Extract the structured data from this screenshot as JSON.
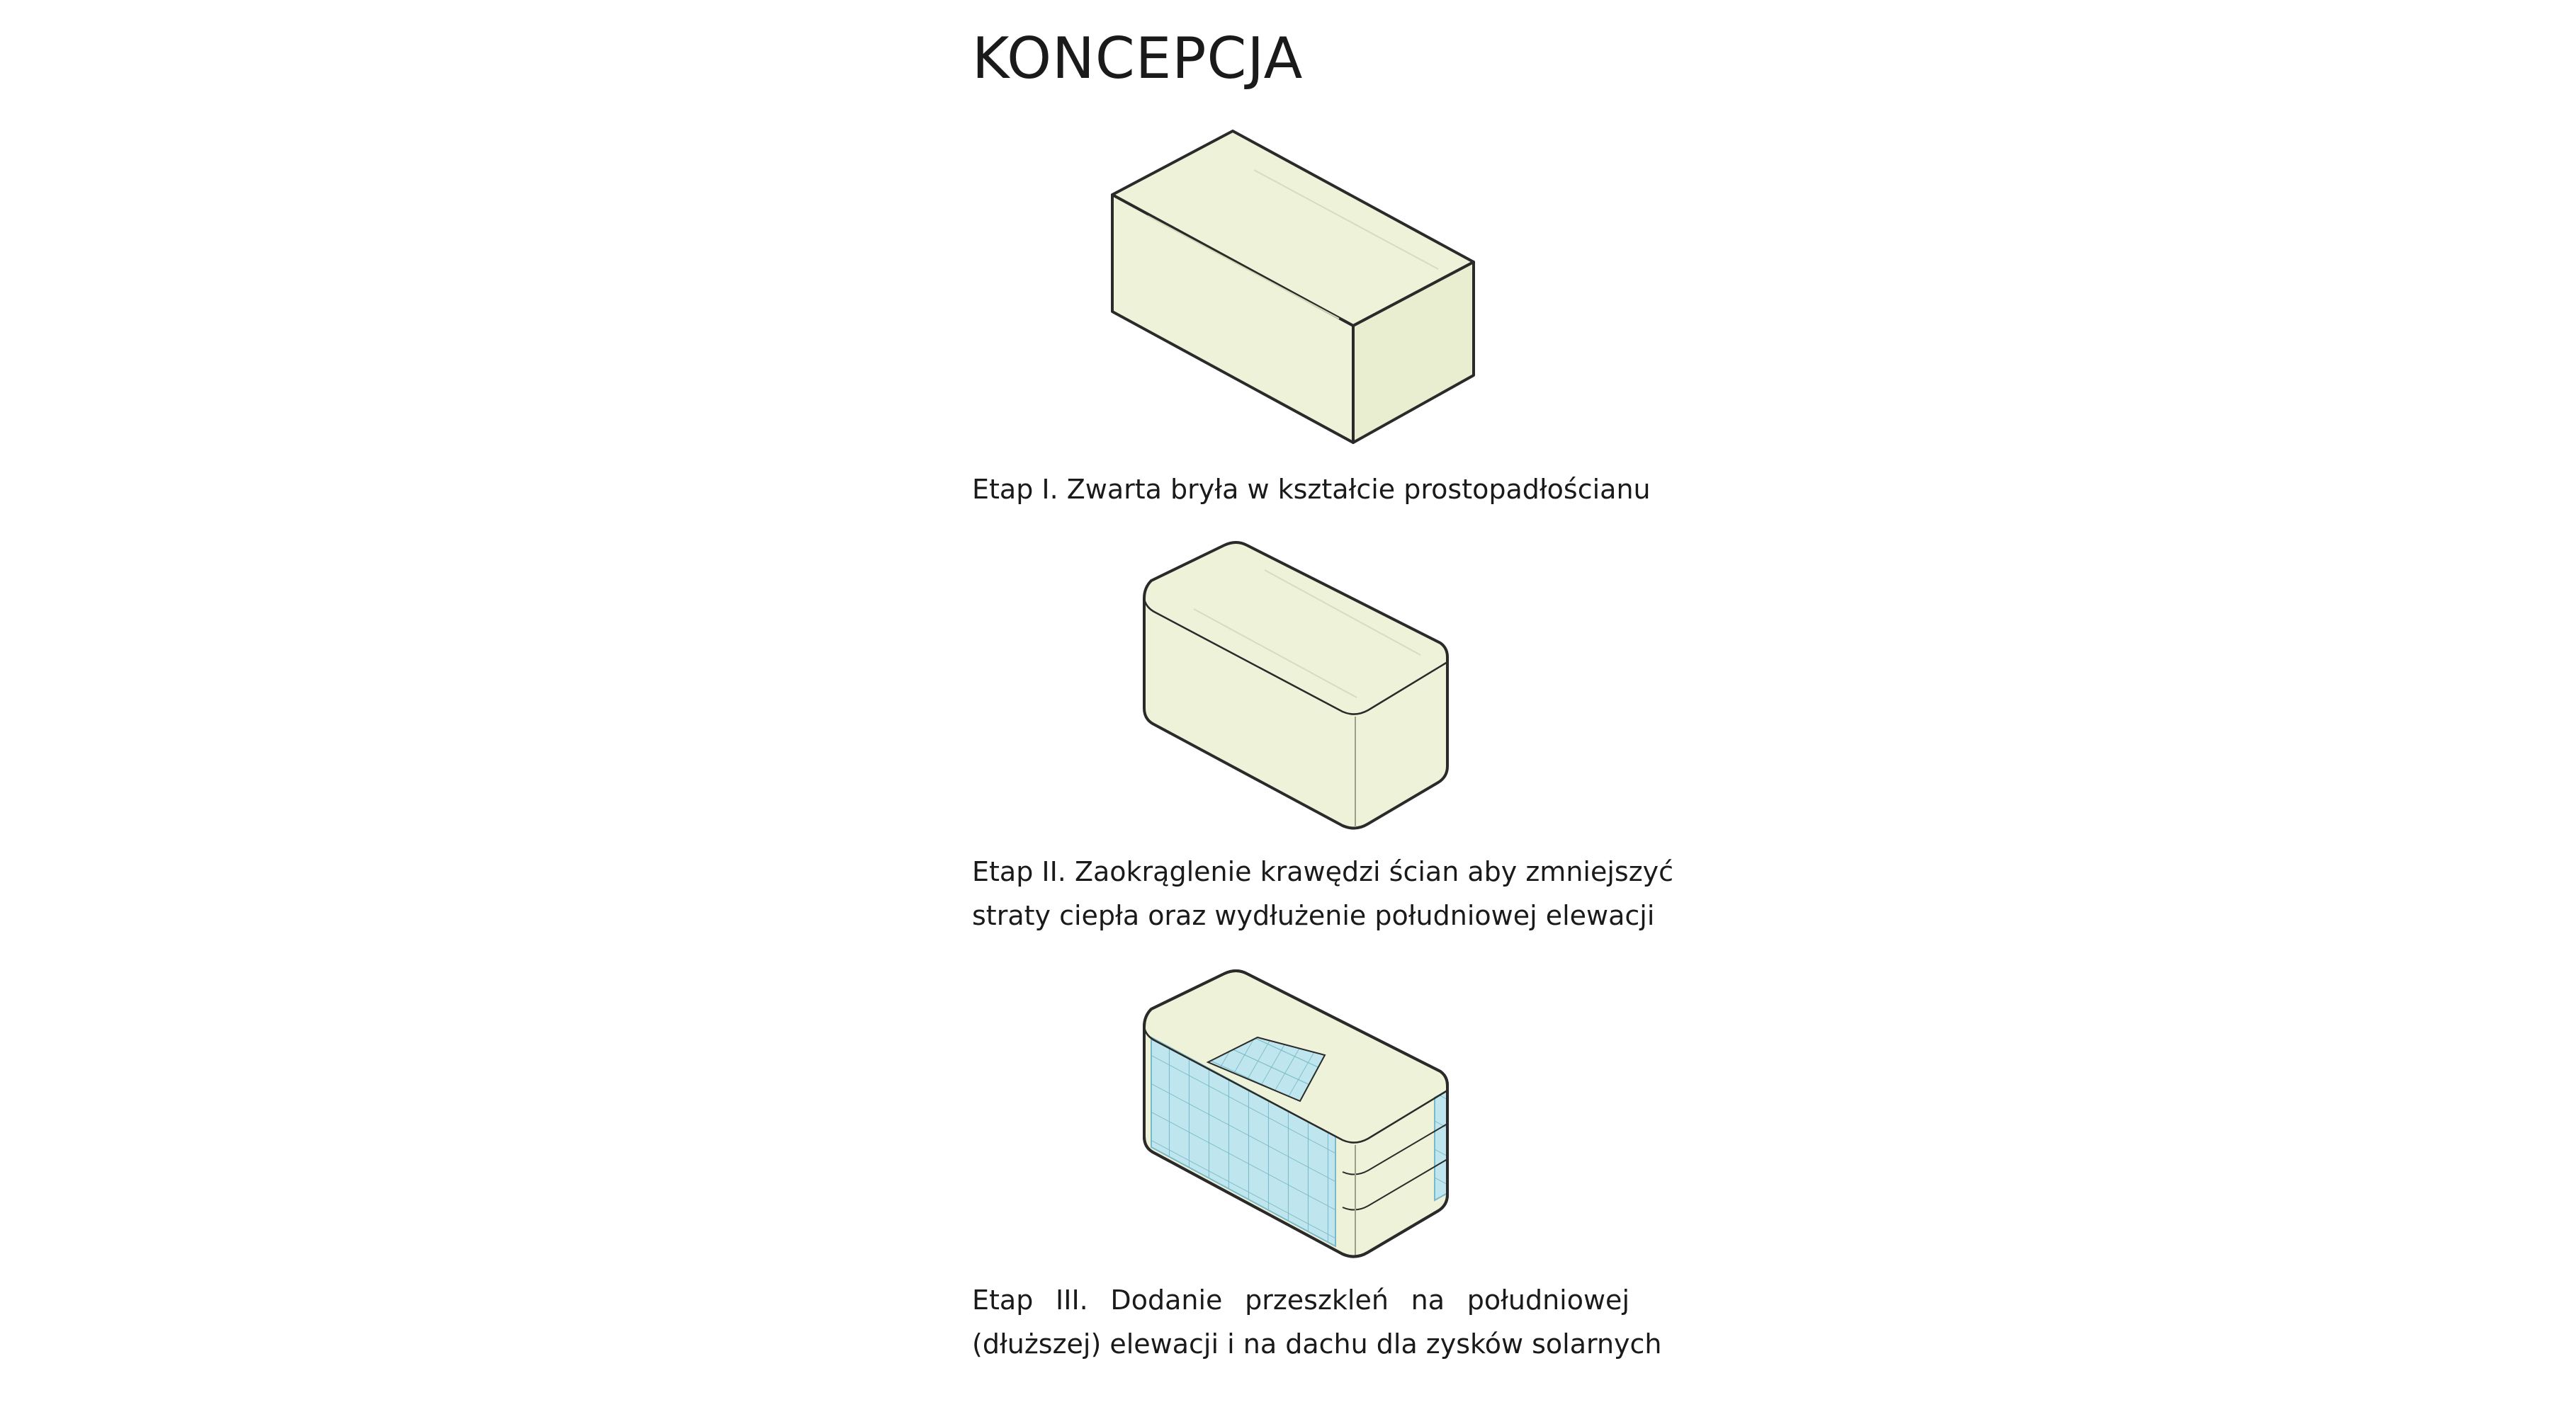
{
  "title": "KONCEPCJA",
  "colors": {
    "volume_fill": "#eef2d8",
    "volume_fill_shade": "#e4ebc8",
    "outline": "#2a2a2a",
    "glass": "#bfe6ee",
    "glass_grid": "#7ab9c8"
  },
  "stages": [
    {
      "caption_lines": [
        "Etap I. Zwarta bryła w kształcie prostopadłościanu"
      ]
    },
    {
      "caption_lines": [
        "Etap II. Zaokrąglenie krawędzi ścian aby zmniejszyć",
        "straty ciepła oraz wydłużenie południowej elewacji"
      ]
    },
    {
      "caption_lines": [
        "Etap III. Dodanie przeszkleń na południowej",
        "(dłuższej) elewacji i na dachu dla zysków solarnych"
      ]
    }
  ]
}
